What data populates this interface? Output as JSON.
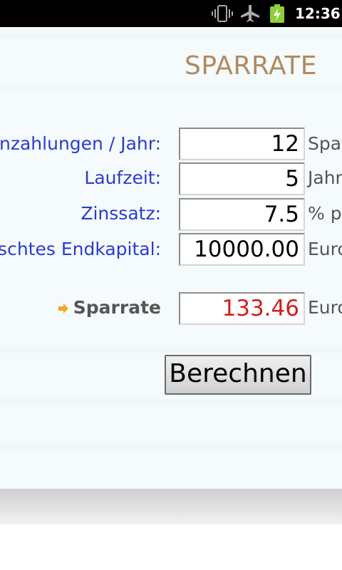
{
  "status_bar": {
    "time": "12:36",
    "icons": [
      "vibrate-icon",
      "airplane-icon",
      "battery-charging-icon"
    ]
  },
  "header": {
    "title": "SPARRATE"
  },
  "form": {
    "fields": [
      {
        "label": "nzahlungen / Jahr:",
        "value": "12",
        "unit": "Spa"
      },
      {
        "label": "Laufzeit:",
        "value": "5",
        "unit": "Jahr"
      },
      {
        "label": "Zinssatz:",
        "value": "7.5",
        "unit": "% p"
      },
      {
        "label": "schtes Endkapital:",
        "value": "10000.00",
        "unit": "Euro"
      }
    ],
    "result": {
      "label": "Sparrate",
      "value": "133.46",
      "unit": "Euro",
      "icon": "arrow-right-icon"
    }
  },
  "actions": {
    "calculate_label": "Berechnen"
  },
  "colors": {
    "title": "#b28a5e",
    "label": "#2b3bd0",
    "result_value": "#d11e1e",
    "background": "#f5fbfc"
  }
}
